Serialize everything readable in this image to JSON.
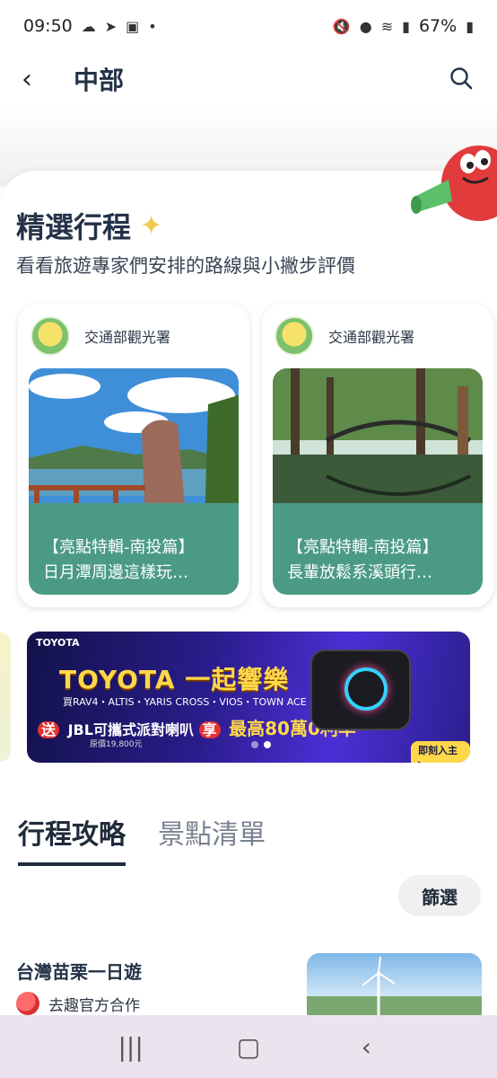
{
  "status_bar": {
    "time": "09:50",
    "battery": "67%"
  },
  "header": {
    "title": "中部"
  },
  "featured": {
    "title": "精選行程",
    "subtitle": "看看旅遊專家們安排的路線與小撇步評價",
    "cards": [
      {
        "org": "交通部觀光署",
        "line1": "【亮點特輯-南投篇】",
        "line2": "日月潭周邊這樣玩…"
      },
      {
        "org": "交通部觀光署",
        "line1": "【亮點特輯-南投篇】",
        "line2": "長輩放鬆系溪頭行…"
      }
    ]
  },
  "ad": {
    "brand": "TOYOTA",
    "headline": "TOYOTA 一起響樂",
    "models": "買RAV4・ALTIS・YARIS CROSS・VIOS・TOWN ACE",
    "offer_send": "送",
    "offer_text": "JBL可攜式派對喇叭",
    "offer_enjoy": "享",
    "offer_rate": "最高80萬0利率",
    "price": "原價19,800元",
    "cta": "即刻入主 ▸"
  },
  "tabs": [
    {
      "label": "行程攻略",
      "active": true
    },
    {
      "label": "景點清單",
      "active": false
    }
  ],
  "filter": {
    "label": "篩選"
  },
  "list": [
    {
      "title": "台灣苗栗一日遊",
      "author": "去趣官方合作"
    }
  ],
  "colors": {
    "card_footer": "#4a9a84",
    "title": "#233247",
    "ad_bg": "#2a1c8a"
  }
}
